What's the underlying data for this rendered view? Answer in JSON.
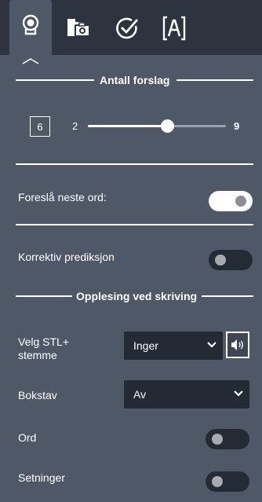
{
  "tabs": [
    {
      "name": "prediction",
      "icon": "speech-head-icon",
      "active": true
    },
    {
      "name": "scanning",
      "icon": "camera-folder-icon",
      "active": false
    },
    {
      "name": "spellcheck",
      "icon": "checkmark-circle-icon",
      "active": false
    },
    {
      "name": "text",
      "icon": "text-box-icon",
      "active": false
    }
  ],
  "suggestions": {
    "title": "Antall forslag",
    "current": "6",
    "min": "2",
    "max": "9",
    "value": 6
  },
  "next_word": {
    "label": "Foreslå neste ord:",
    "on": true
  },
  "corrective": {
    "label": "Korrektiv prediksjon",
    "on": false
  },
  "reading": {
    "title": "Opplesing ved skriving",
    "voice_label_line1": "Velg STL+",
    "voice_label_line2": "stemme",
    "voice_value": "Inger",
    "letter_label": "Bokstav",
    "letter_value": "Av",
    "word_label": "Ord",
    "word_on": false,
    "sentence_label": "Setninger",
    "sentence_on": false
  },
  "colors": {
    "panel": "#4f5867",
    "topbar": "#2d3440",
    "dark_control": "#232a34"
  }
}
